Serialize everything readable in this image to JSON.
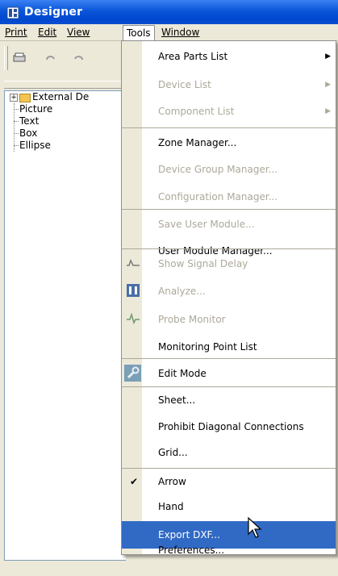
{
  "window": {
    "title": "Designer",
    "accent": "#0a55d8"
  },
  "menubar": {
    "items": [
      "Print",
      "Edit",
      "View",
      "Tools",
      "Window"
    ],
    "active": "Tools"
  },
  "tree": {
    "items": [
      "External De",
      "Picture",
      "Text",
      "Box",
      "Ellipse"
    ]
  },
  "tools_menu": {
    "selected_color": "#316ac5",
    "items": [
      {
        "label": "Area Parts List",
        "has_submenu": true
      },
      {
        "label": "Device List",
        "disabled": true,
        "has_submenu": true
      },
      {
        "label": "Component List",
        "disabled": true,
        "has_submenu": true
      },
      {
        "label": "Zone Manager..."
      },
      {
        "label": "Device Group Manager...",
        "disabled": true
      },
      {
        "label": "Configuration Manager...",
        "disabled": true
      },
      {
        "label": "Save User Module...",
        "disabled": true
      },
      {
        "label": "User Module Manager..."
      },
      {
        "label": "Show Signal Delay",
        "disabled": true,
        "icon": "signal-delay-icon"
      },
      {
        "label": "Analyze...",
        "disabled": true,
        "icon": "analyze-icon"
      },
      {
        "label": "Probe Monitor",
        "disabled": true,
        "icon": "probe-icon"
      },
      {
        "label": "Monitoring Point List"
      },
      {
        "label": "Edit Mode",
        "icon": "wrench-icon"
      },
      {
        "label": "Sheet..."
      },
      {
        "label": "Prohibit Diagonal Connections"
      },
      {
        "label": "Grid..."
      },
      {
        "label": "Arrow",
        "checked": true
      },
      {
        "label": "Hand"
      },
      {
        "label": "Export DXF...",
        "selected": true
      },
      {
        "label": "Preferences..."
      }
    ]
  }
}
